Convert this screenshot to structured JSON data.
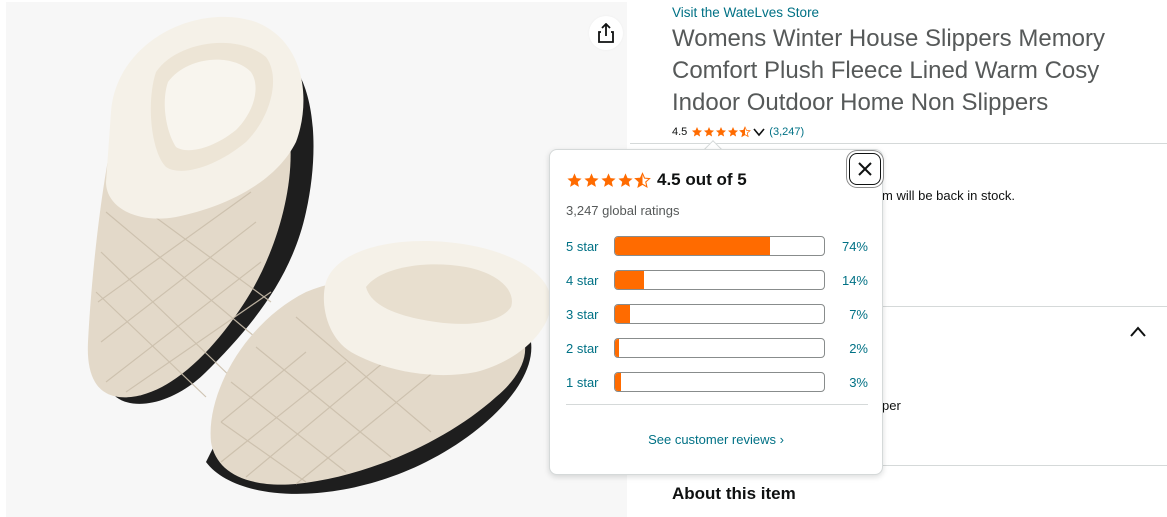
{
  "store_link": "Visit the WateLves Store",
  "title": "Womens Winter House Slippers Memory Comfort Plush Fleece Lined Warm Cosy Indoor Outdoor Home Non Slippers",
  "rating": {
    "value": "4.5",
    "count": "(3,247)",
    "stars_value": 4.5
  },
  "availability_fragment": "m will be back in stock.",
  "side_fragment": "per",
  "about_heading": "About this item",
  "popover": {
    "score": "4.5 out of 5",
    "global_ratings": "3,247 global ratings",
    "histogram": [
      {
        "label": "5 star",
        "pct": "74%",
        "value": 74
      },
      {
        "label": "4 star",
        "pct": "14%",
        "value": 14
      },
      {
        "label": "3 star",
        "pct": "7%",
        "value": 7
      },
      {
        "label": "2 star",
        "pct": "2%",
        "value": 2
      },
      {
        "label": "1 star",
        "pct": "3%",
        "value": 3
      }
    ],
    "see_reviews": "See customer reviews ›"
  },
  "colors": {
    "star": "#ff6b00",
    "link": "#007185",
    "bar_fill": "#ff6b00"
  },
  "icons": {
    "share": "share-icon",
    "close": "close-icon",
    "chevron_down": "chevron-down-icon",
    "chevron_up": "chevron-up-icon",
    "star": "star-icon"
  }
}
